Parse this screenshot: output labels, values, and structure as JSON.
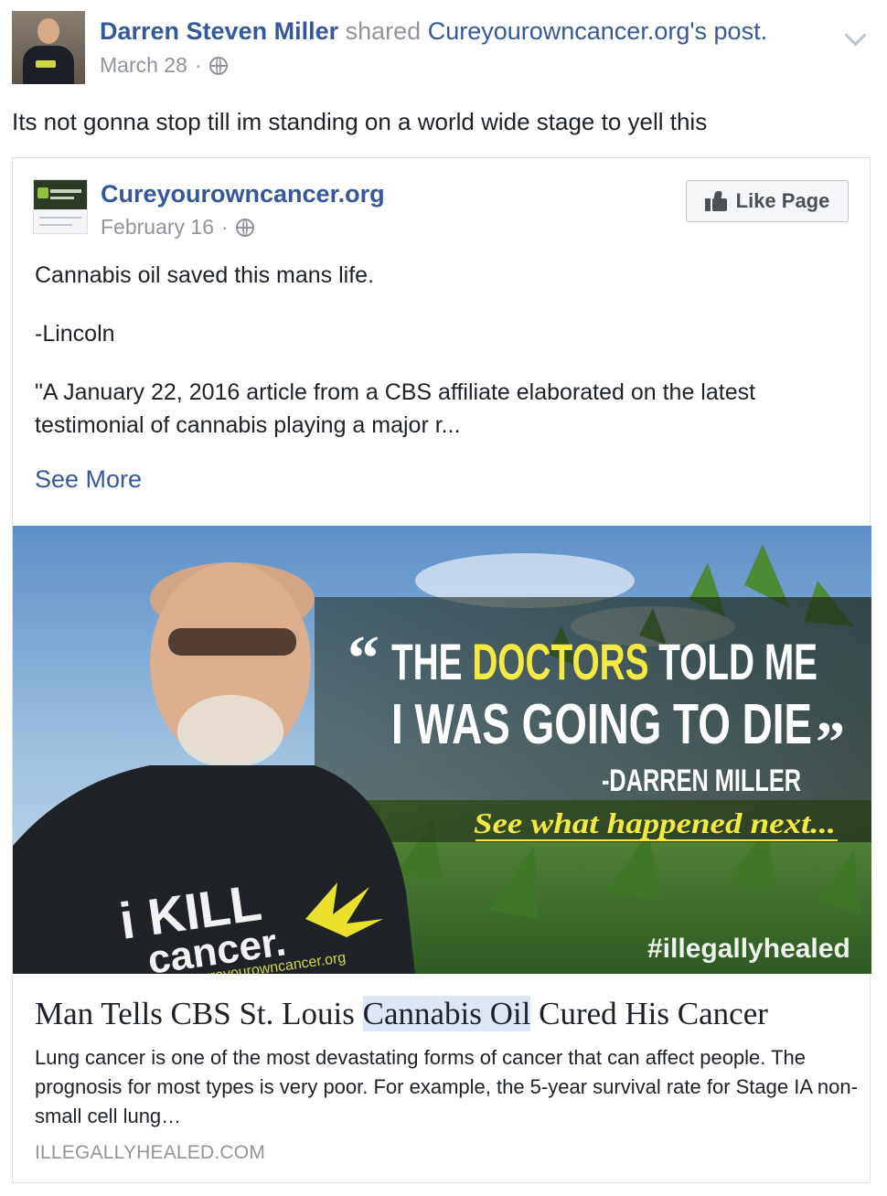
{
  "post": {
    "author": "Darren Steven Miller",
    "shared_verb": "shared",
    "shared_source": "Cureyourowncancer.org's",
    "shared_object": "post.",
    "date": "March 28",
    "dot": "·",
    "status_text": "Its not gonna stop till im standing on a world wide stage to yell this"
  },
  "shared_post": {
    "page_name": "Cureyourowncancer.org",
    "date": "February 16",
    "dot": "·",
    "like_button_label": "Like Page",
    "text_line1": "Cannabis oil saved this mans life.",
    "text_line2": "-Lincoln",
    "text_line3": "\"A January 22, 2016 article from a CBS affiliate elaborated on the latest",
    "text_line4": "testimonial of cannabis playing a major r...",
    "see_more": "See More"
  },
  "image": {
    "quote_open": "“",
    "quote_line1_word1": "THE",
    "quote_line1_word2": "DOCTORS",
    "quote_line1_word3": "TOLD ME",
    "quote_line2": "I WAS GOING TO DIE",
    "quote_close": "”",
    "attribution": "-DARREN MILLER",
    "teaser": "See what happened next...",
    "hashtag": "#illegallyhealed",
    "shirt_line1": "i KILL",
    "shirt_line2": "cancer.",
    "shirt_small": "cureyourowncancer.org"
  },
  "link": {
    "title_part1": "Man Tells CBS St. Louis ",
    "title_highlight": "Cannabis Oil",
    "title_part2": " Cured His Cancer",
    "description": "Lung cancer is one of the most devastating forms of cancer that can affect people. The prognosis for most types is very poor. For example, the 5-year survival rate for Stage IA non-small cell lung…",
    "domain": "ILLEGALLYHEALED.COM"
  },
  "colors": {
    "link_blue": "#365899",
    "muted_gray": "#90949c",
    "text": "#1d2129",
    "quote_yellow": "#f4e842"
  },
  "icons": [
    "globe-icon",
    "chevron-down-icon",
    "thumbs-up-icon"
  ]
}
